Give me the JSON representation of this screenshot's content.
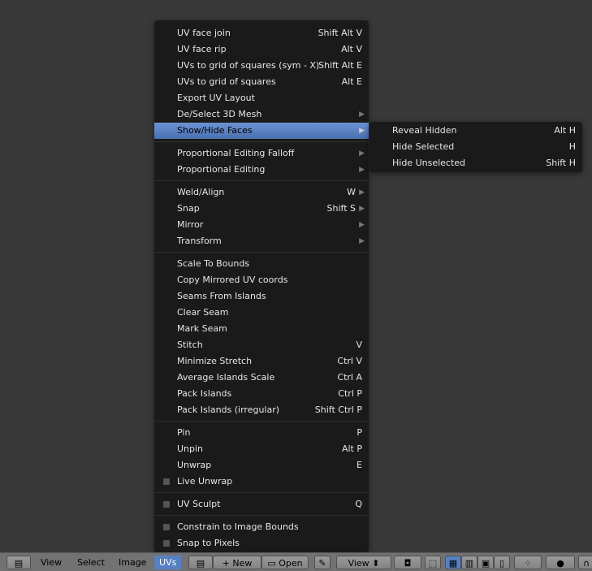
{
  "menu": {
    "items": [
      {
        "label": "UV face join",
        "shortcut": "Shift Alt V"
      },
      {
        "label": "UV face rip",
        "shortcut": "Alt V"
      },
      {
        "label": "UVs to grid of squares (sym - X)",
        "shortcut": "Shift Alt E"
      },
      {
        "label": "UVs to grid of squares",
        "shortcut": "Alt E"
      },
      {
        "label": "Export UV Layout",
        "shortcut": ""
      },
      {
        "label": "De/Select 3D Mesh",
        "shortcut": "",
        "submenu": true
      },
      {
        "label": "Show/Hide Faces",
        "shortcut": "",
        "submenu": true,
        "active": true
      },
      {
        "separator": true
      },
      {
        "label": "Proportional Editing Falloff",
        "shortcut": "",
        "submenu": true
      },
      {
        "label": "Proportional Editing",
        "shortcut": "",
        "submenu": true
      },
      {
        "separator": true
      },
      {
        "label": "Weld/Align",
        "shortcut": "W",
        "submenu": true
      },
      {
        "label": "Snap",
        "shortcut": "Shift S",
        "submenu": true
      },
      {
        "label": "Mirror",
        "shortcut": "",
        "submenu": true
      },
      {
        "label": "Transform",
        "shortcut": "",
        "submenu": true
      },
      {
        "separator": true
      },
      {
        "label": "Scale To Bounds",
        "shortcut": ""
      },
      {
        "label": "Copy Mirrored UV coords",
        "shortcut": ""
      },
      {
        "label": "Seams From Islands",
        "shortcut": ""
      },
      {
        "label": "Clear Seam",
        "shortcut": ""
      },
      {
        "label": "Mark Seam",
        "shortcut": ""
      },
      {
        "label": "Stitch",
        "shortcut": "V"
      },
      {
        "label": "Minimize Stretch",
        "shortcut": "Ctrl V"
      },
      {
        "label": "Average Islands Scale",
        "shortcut": "Ctrl A"
      },
      {
        "label": "Pack Islands",
        "shortcut": "Ctrl P"
      },
      {
        "label": "Pack Islands (irregular)",
        "shortcut": "Shift Ctrl P"
      },
      {
        "separator": true
      },
      {
        "label": "Pin",
        "shortcut": "P"
      },
      {
        "label": "Unpin",
        "shortcut": "Alt P"
      },
      {
        "label": "Unwrap",
        "shortcut": "E"
      },
      {
        "label": "Live Unwrap",
        "shortcut": "",
        "checkbox": false
      },
      {
        "separator": true
      },
      {
        "label": "UV Sculpt",
        "shortcut": "Q",
        "checkbox": false
      },
      {
        "separator": true
      },
      {
        "label": "Constrain to Image Bounds",
        "shortcut": "",
        "checkbox": false
      },
      {
        "label": "Snap to Pixels",
        "shortcut": "",
        "checkbox": false
      }
    ]
  },
  "submenu": {
    "items": [
      {
        "label": "Reveal Hidden",
        "shortcut": "Alt H"
      },
      {
        "label": "Hide Selected",
        "shortcut": "H"
      },
      {
        "label": "Hide Unselected",
        "shortcut": "Shift H"
      }
    ]
  },
  "header": {
    "view": "View",
    "select": "Select",
    "image": "Image",
    "uvs": "UVs",
    "new": "New",
    "open": "Open",
    "display": "View"
  },
  "colors": {
    "highlight": "#5680c2",
    "menu_bg": "#1a1a1a",
    "background": "#393939"
  }
}
